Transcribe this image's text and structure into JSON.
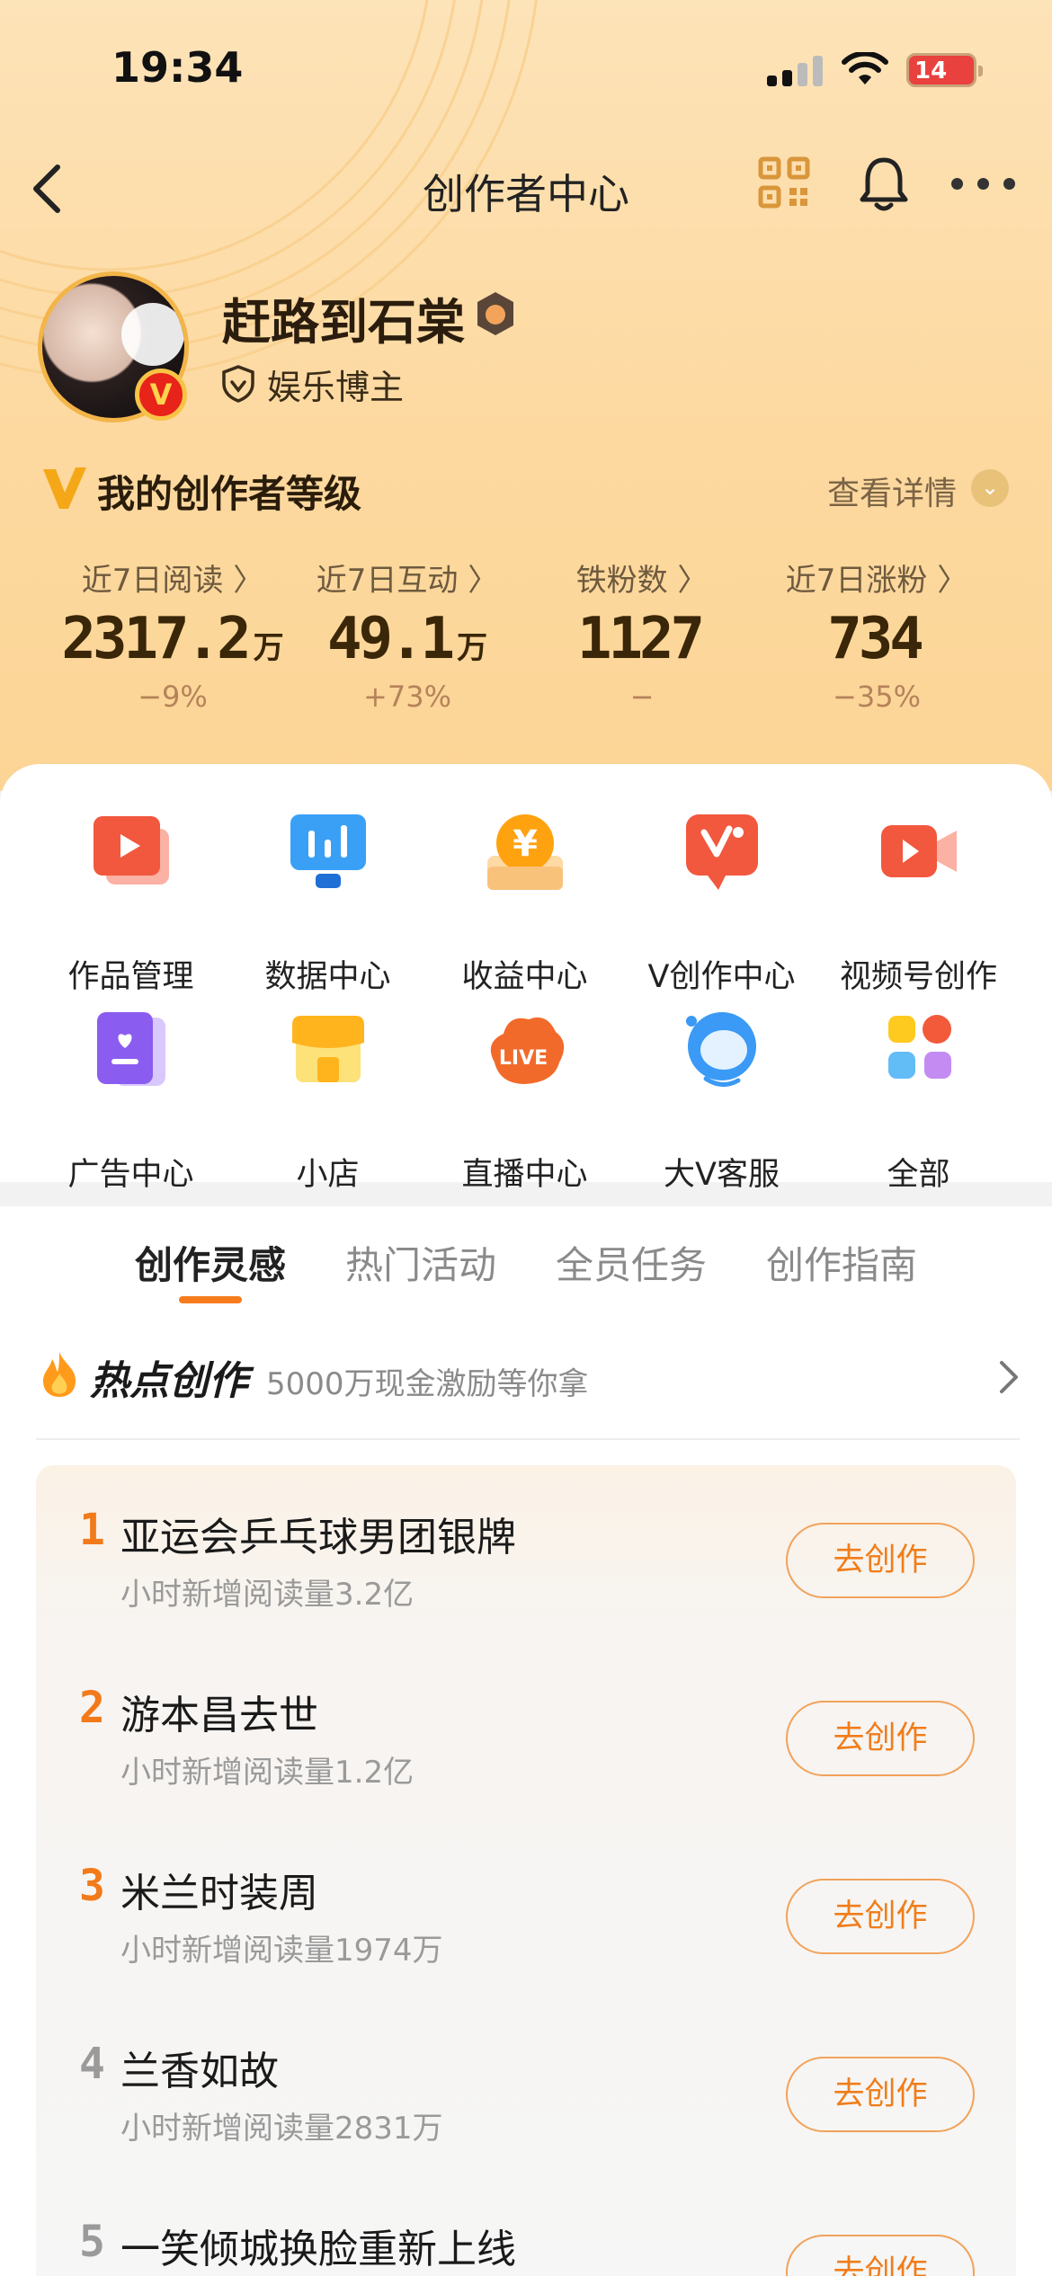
{
  "status_bar": {
    "time": "19:34",
    "battery": "14"
  },
  "nav": {
    "title": "创作者中心"
  },
  "profile": {
    "name": "赶路到石棠",
    "tag": "娱乐博主",
    "badge": "V"
  },
  "level": {
    "title": "我的创作者等级",
    "detail": "查看详情"
  },
  "stats": [
    {
      "label": "近7日阅读 〉",
      "value": "2317.2",
      "unit": "万",
      "change": "−9%"
    },
    {
      "label": "近7日互动 〉",
      "value": "49.1",
      "unit": "万",
      "change": "+73%"
    },
    {
      "label": "铁粉数 〉",
      "value": "1127",
      "unit": "",
      "change": "−"
    },
    {
      "label": "近7日涨粉 〉",
      "value": "734",
      "unit": "",
      "change": "−35%"
    }
  ],
  "tools": [
    {
      "label": "作品管理",
      "icon": "video-play-icon"
    },
    {
      "label": "数据中心",
      "icon": "data-chart-icon"
    },
    {
      "label": "收益中心",
      "icon": "yuan-coin-icon"
    },
    {
      "label": "V创作中心",
      "icon": "v-creator-icon"
    },
    {
      "label": "视频号创作",
      "icon": "video-camera-icon"
    },
    {
      "label": "广告中心",
      "icon": "ad-book-icon"
    },
    {
      "label": "小店",
      "icon": "shop-icon"
    },
    {
      "label": "直播中心",
      "icon": "live-icon"
    },
    {
      "label": "大V客服",
      "icon": "customer-service-icon"
    },
    {
      "label": "全部",
      "icon": "all-apps-icon"
    }
  ],
  "tabs": [
    "创作灵感",
    "热门活动",
    "全员任务",
    "创作指南"
  ],
  "hot": {
    "title": "热点创作",
    "subtitle": "5000万现金激励等你拿"
  },
  "hot_list": [
    {
      "rank": "1",
      "title": "亚运会乒乓球男团银牌",
      "sub": "小时新增阅读量3.2亿",
      "button": "去创作"
    },
    {
      "rank": "2",
      "title": "游本昌去世",
      "sub": "小时新增阅读量1.2亿",
      "button": "去创作"
    },
    {
      "rank": "3",
      "title": "米兰时装周",
      "sub": "小时新增阅读量1974万",
      "button": "去创作"
    },
    {
      "rank": "4",
      "title": "兰香如故",
      "sub": "小时新增阅读量2831万",
      "button": "去创作"
    },
    {
      "rank": "5",
      "title": "一笑倾城换脸重新上线",
      "sub": "",
      "button": "去创作"
    }
  ],
  "colors": {
    "accent": "#f07d1a",
    "hero": "#fdd9a0",
    "rank_top": "#f27a1a",
    "rank_other": "#9a9a9a"
  }
}
